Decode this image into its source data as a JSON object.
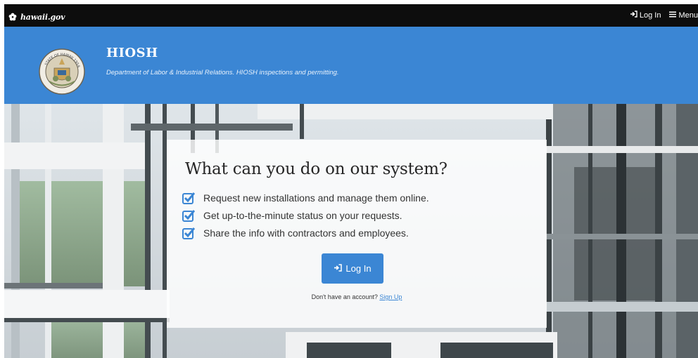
{
  "topbar": {
    "brand": "hawaii.gov",
    "login": "Log In",
    "menu": "Menu"
  },
  "header": {
    "title": "HIOSH",
    "subtitle": "Department of Labor & Industrial Relations. HIOSH inspections and permitting.",
    "seal_text": "STATE OF HAWAII 1959"
  },
  "card": {
    "title": "What can you do on our system?",
    "features": [
      "Request new installations and manage them online.",
      "Get up-to-the-minute status on your requests.",
      "Share the info with contractors and employees."
    ],
    "login_button": "Log In",
    "signup_prompt": "Don't have an account?",
    "signup_link": "Sign Up"
  },
  "colors": {
    "accent": "#3b86d4",
    "topbar": "#0d0d0d"
  },
  "icons": [
    "flower-icon",
    "login-icon",
    "menu-icon",
    "state-seal-icon",
    "checkbox-checked-icon"
  ]
}
